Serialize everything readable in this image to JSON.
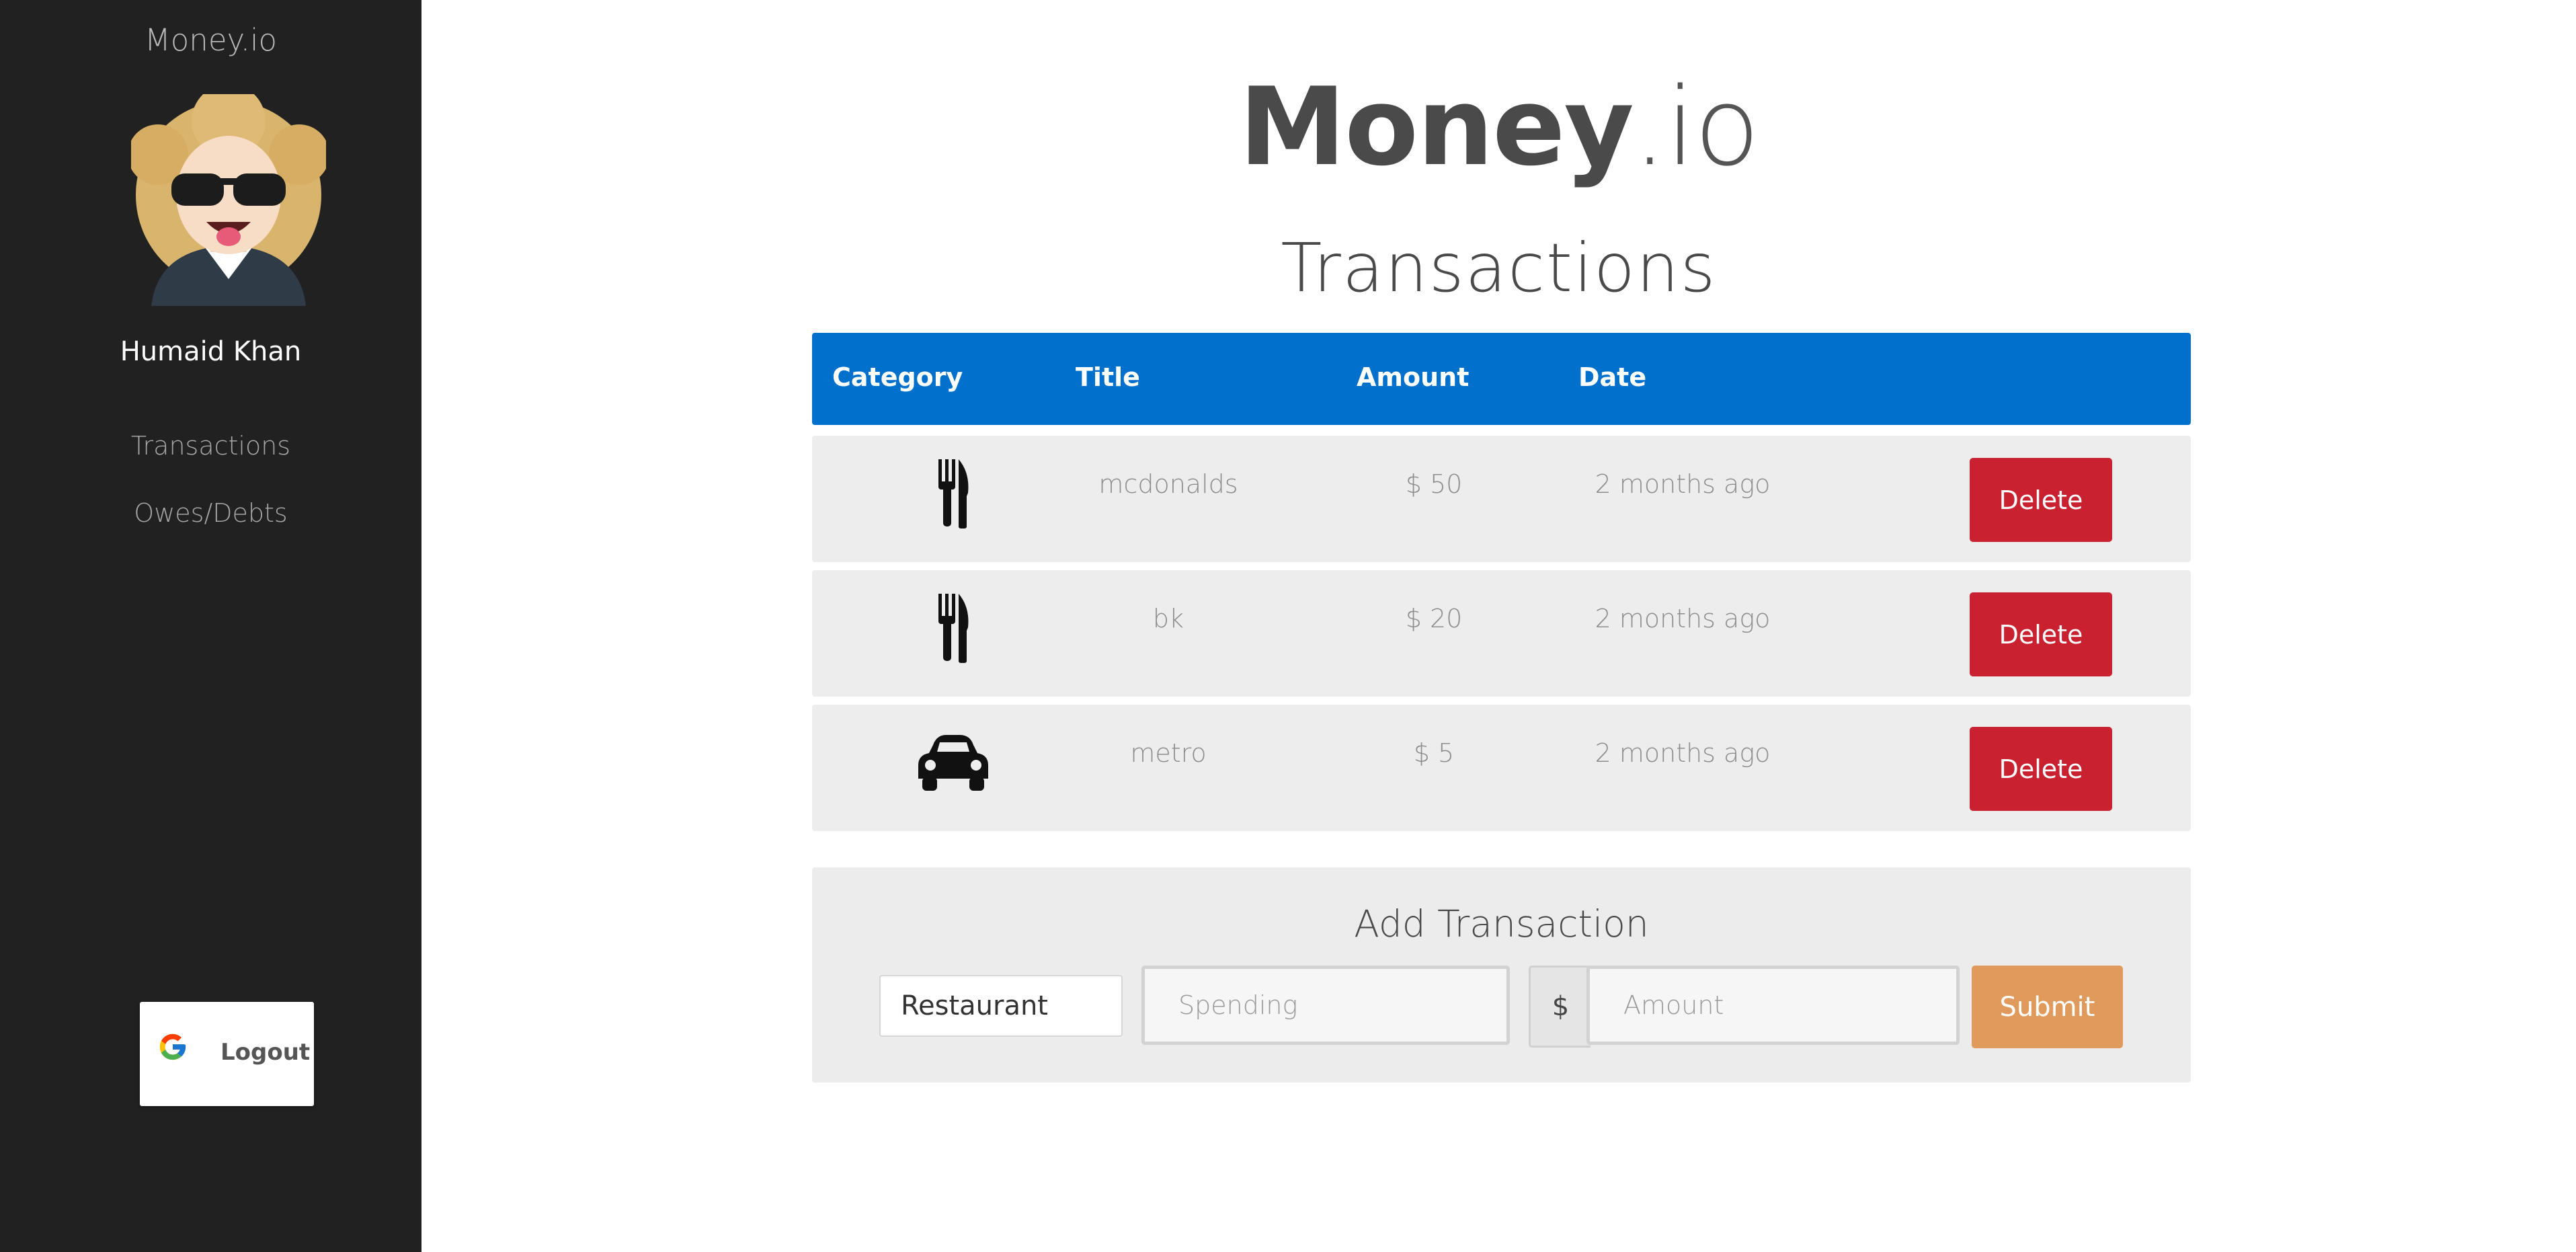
{
  "sidebar": {
    "brand": "Money.io",
    "user_name": "Humaid Khan",
    "nav": [
      {
        "label": "Transactions"
      },
      {
        "label": "Owes/Debts"
      }
    ],
    "logout_label": "Logout"
  },
  "header": {
    "title_bold": "Money",
    "title_light": ".io",
    "section": "Transactions"
  },
  "table": {
    "columns": [
      "Category",
      "Title",
      "Amount",
      "Date"
    ],
    "rows": [
      {
        "category_icon": "restaurant-icon",
        "title": "mcdonalds",
        "amount": "$ 50",
        "date": "2 months ago",
        "action": "Delete"
      },
      {
        "category_icon": "restaurant-icon",
        "title": "bk",
        "amount": "$ 20",
        "date": "2 months ago",
        "action": "Delete"
      },
      {
        "category_icon": "car-icon",
        "title": "metro",
        "amount": "$ 5",
        "date": "2 months ago",
        "action": "Delete"
      }
    ]
  },
  "add_form": {
    "title": "Add Transaction",
    "category_value": "Restaurant",
    "title_placeholder": "Spending",
    "currency_addon": "$",
    "amount_placeholder": "Amount",
    "submit_label": "Submit"
  },
  "colors": {
    "sidebar_bg": "#212121",
    "header_blue": "#0070cd",
    "delete_red": "#c9212f",
    "submit_orange": "#e09a5b"
  }
}
